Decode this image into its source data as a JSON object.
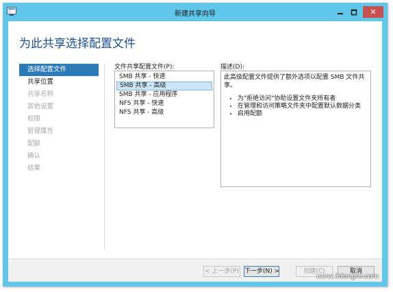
{
  "window": {
    "title": "新建共享向导",
    "close_glyph": "✕",
    "icons": [
      "app-icon",
      "minimize-icon",
      "maximize-icon",
      "close-icon"
    ]
  },
  "page_title": "为此共享选择配置文件",
  "nav": {
    "items": [
      {
        "label": "选择配置文件",
        "state": "active"
      },
      {
        "label": "共享位置",
        "state": "enabled"
      },
      {
        "label": "共享名称",
        "state": "disabled"
      },
      {
        "label": "其他设置",
        "state": "disabled"
      },
      {
        "label": "权限",
        "state": "disabled"
      },
      {
        "label": "管理属性",
        "state": "disabled"
      },
      {
        "label": "配额",
        "state": "disabled"
      },
      {
        "label": "确认",
        "state": "disabled"
      },
      {
        "label": "结果",
        "state": "disabled"
      }
    ]
  },
  "profiles": {
    "label": "文件共享配置文件(P):",
    "items": [
      "SMB 共享 - 快速",
      "SMB 共享 - 高级",
      "SMB 共享 - 应用程序",
      "NFS 共享 - 快速",
      "NFS 共享 - 高级"
    ],
    "selected_index": 1
  },
  "description": {
    "label": "描述(D):",
    "text": "此高级配置文件提供了额外选项以配置 SMB 文件共享。",
    "bullets": [
      "为\"拒绝访问\"协助设置文件夹所有者",
      "在管理和访问策略文件夹中配置默认数据分类",
      "启用配额"
    ]
  },
  "buttons": {
    "prev": "< 上一步(P)",
    "next": "下一步(N) >",
    "create": "创建(C)",
    "cancel": "取消"
  },
  "colors": {
    "title_bar": "#60c6ea",
    "accent": "#2d7ab9",
    "heading": "#1e4f91",
    "close_button": "#c75050"
  },
  "watermark": "www.lidongni.com"
}
